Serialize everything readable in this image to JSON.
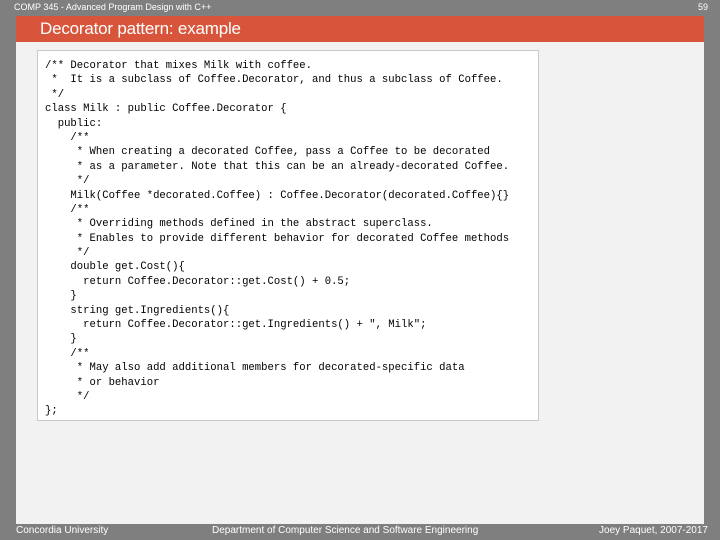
{
  "header": {
    "course": "COMP 345 - Advanced Program Design with C++",
    "page_number": "59"
  },
  "slide": {
    "title": "Decorator pattern: example"
  },
  "code": {
    "lines": [
      "/** Decorator that mixes Milk with coffee.",
      " *  It is a subclass of Coffee.Decorator, and thus a subclass of Coffee.",
      " */",
      "class Milk : public Coffee.Decorator {",
      "  public:",
      "    /**",
      "     * When creating a decorated Coffee, pass a Coffee to be decorated",
      "     * as a parameter. Note that this can be an already-decorated Coffee.",
      "     */",
      "    Milk(Coffee *decorated.Coffee) : Coffee.Decorator(decorated.Coffee){}",
      "    /**",
      "     * Overriding methods defined in the abstract superclass.",
      "     * Enables to provide different behavior for decorated Coffee methods",
      "     */",
      "    double get.Cost(){",
      "      return Coffee.Decorator::get.Cost() + 0.5;",
      "    }",
      "    string get.Ingredients(){",
      "      return Coffee.Decorator::get.Ingredients() + \", Milk\";",
      "    }",
      "    /**",
      "     * May also add additional members for decorated-specific data",
      "     * or behavior",
      "     */",
      "};"
    ]
  },
  "footer": {
    "left": "Concordia University",
    "center": "Department of Computer Science and Software Engineering",
    "right": "Joey Paquet, 2007-2017"
  }
}
